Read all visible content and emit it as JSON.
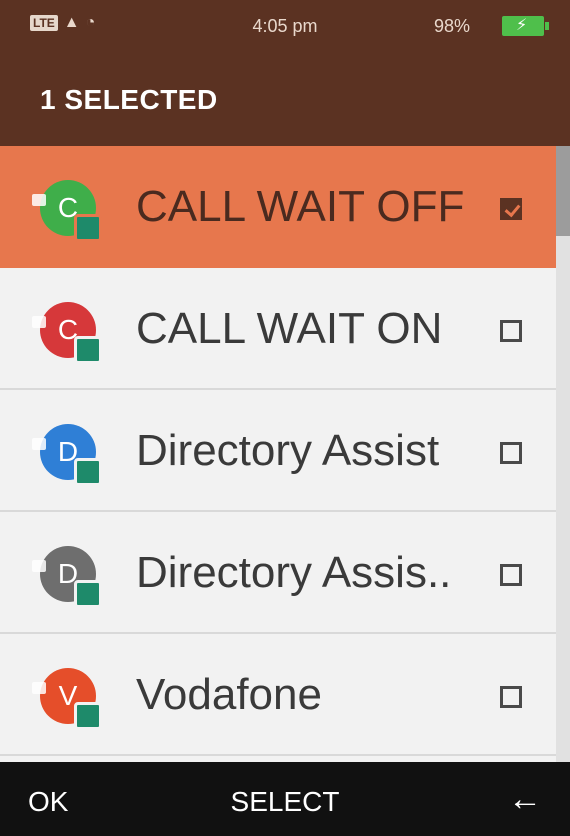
{
  "status_bar": {
    "network": "LTE",
    "time": "4:05 pm",
    "battery": "98%"
  },
  "header": {
    "title": "1 SELECTED"
  },
  "contacts": [
    {
      "label": "CALL WAIT OFF",
      "initial": "C",
      "avatar_color": "#3fae4a",
      "selected": true
    },
    {
      "label": "CALL WAIT ON",
      "initial": "C",
      "avatar_color": "#d6383a",
      "selected": false
    },
    {
      "label": "Directory Assist",
      "initial": "D",
      "avatar_color": "#2f7fd6",
      "selected": false
    },
    {
      "label": "Directory Assis..",
      "initial": "D",
      "avatar_color": "#6e6e6e",
      "selected": false
    },
    {
      "label": "Vodafone",
      "initial": "V",
      "avatar_color": "#e54e2a",
      "selected": false
    }
  ],
  "softkeys": {
    "left": "OK",
    "center": "SELECT",
    "right": "←"
  },
  "colors": {
    "brand": "#5b3222",
    "highlight": "#e7774d"
  }
}
